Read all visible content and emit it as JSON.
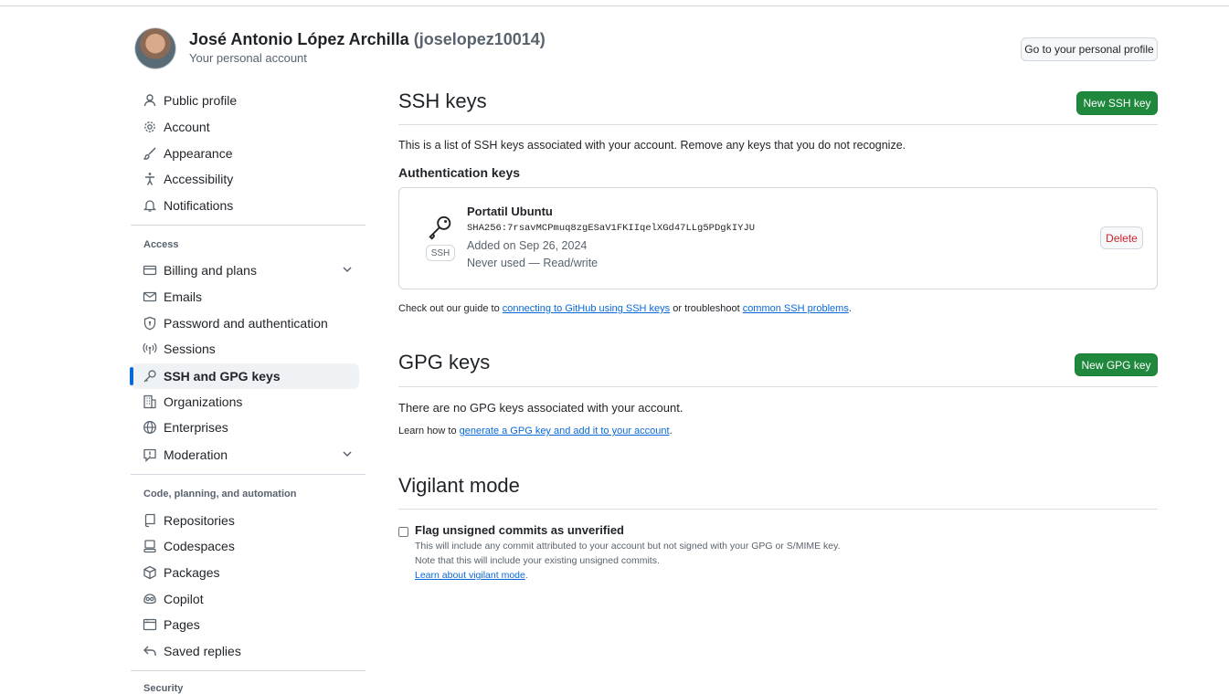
{
  "header": {
    "name": "José Antonio López Archilla",
    "login": "(joselopez10014)",
    "subtitle": "Your personal account",
    "profile_button": "Go to your personal profile"
  },
  "sidebar": {
    "items": [
      {
        "label": "Public profile"
      },
      {
        "label": "Account"
      },
      {
        "label": "Appearance"
      },
      {
        "label": "Accessibility"
      },
      {
        "label": "Notifications"
      }
    ],
    "access_heading": "Access",
    "access_items": [
      {
        "label": "Billing and plans"
      },
      {
        "label": "Emails"
      },
      {
        "label": "Password and authentication"
      },
      {
        "label": "Sessions"
      },
      {
        "label": "SSH and GPG keys"
      },
      {
        "label": "Organizations"
      },
      {
        "label": "Enterprises"
      },
      {
        "label": "Moderation"
      }
    ],
    "code_heading": "Code, planning, and automation",
    "code_items": [
      {
        "label": "Repositories"
      },
      {
        "label": "Codespaces"
      },
      {
        "label": "Packages"
      },
      {
        "label": "Copilot"
      },
      {
        "label": "Pages"
      },
      {
        "label": "Saved replies"
      }
    ],
    "security_heading": "Security"
  },
  "ssh": {
    "title": "SSH keys",
    "new_button": "New SSH key",
    "description": "This is a list of SSH keys associated with your account. Remove any keys that you do not recognize.",
    "auth_heading": "Authentication keys",
    "key": {
      "title": "Portatil Ubuntu",
      "fingerprint": "SHA256:7rsavMCPmuq8zgESaV1FKIIqelXGd47LLg5PDgkIYJU",
      "added": "Added on Sep 26, 2024",
      "usage": "Never used — Read/write",
      "badge": "SSH",
      "delete_button": "Delete"
    },
    "guide_prefix": "Check out our guide to ",
    "guide_link1": "connecting to GitHub using SSH keys",
    "guide_middle": " or troubleshoot ",
    "guide_link2": "common SSH problems",
    "guide_suffix": "."
  },
  "gpg": {
    "title": "GPG keys",
    "new_button": "New GPG key",
    "empty_text": "There are no GPG keys associated with your account.",
    "learn_prefix": "Learn how to ",
    "learn_link": "generate a GPG key and add it to your account",
    "learn_suffix": "."
  },
  "vigilant": {
    "title": "Vigilant mode",
    "checkbox_label": "Flag unsigned commits as unverified",
    "checked": false,
    "note1": "This will include any commit attributed to your account but not signed with your GPG or S/MIME key.",
    "note2": "Note that this will include your existing unsigned commits.",
    "learn_link": "Learn about vigilant mode",
    "learn_suffix": "."
  },
  "colors": {
    "primary_button": "#1f883d",
    "link": "#0969da",
    "active_indicator": "#0969da",
    "danger": "#cf222e"
  },
  "icons": {
    "sidebar": [
      "person-icon",
      "gear-icon",
      "paintbrush-icon",
      "accessibility-icon",
      "bell-icon",
      "credit-card-icon",
      "mail-icon",
      "shield-lock-icon",
      "broadcast-icon",
      "key-icon",
      "organization-icon",
      "globe-icon",
      "report-icon",
      "repo-icon",
      "codespaces-icon",
      "package-icon",
      "copilot-icon",
      "browser-icon",
      "reply-icon"
    ],
    "key_tile": "key-icon"
  }
}
